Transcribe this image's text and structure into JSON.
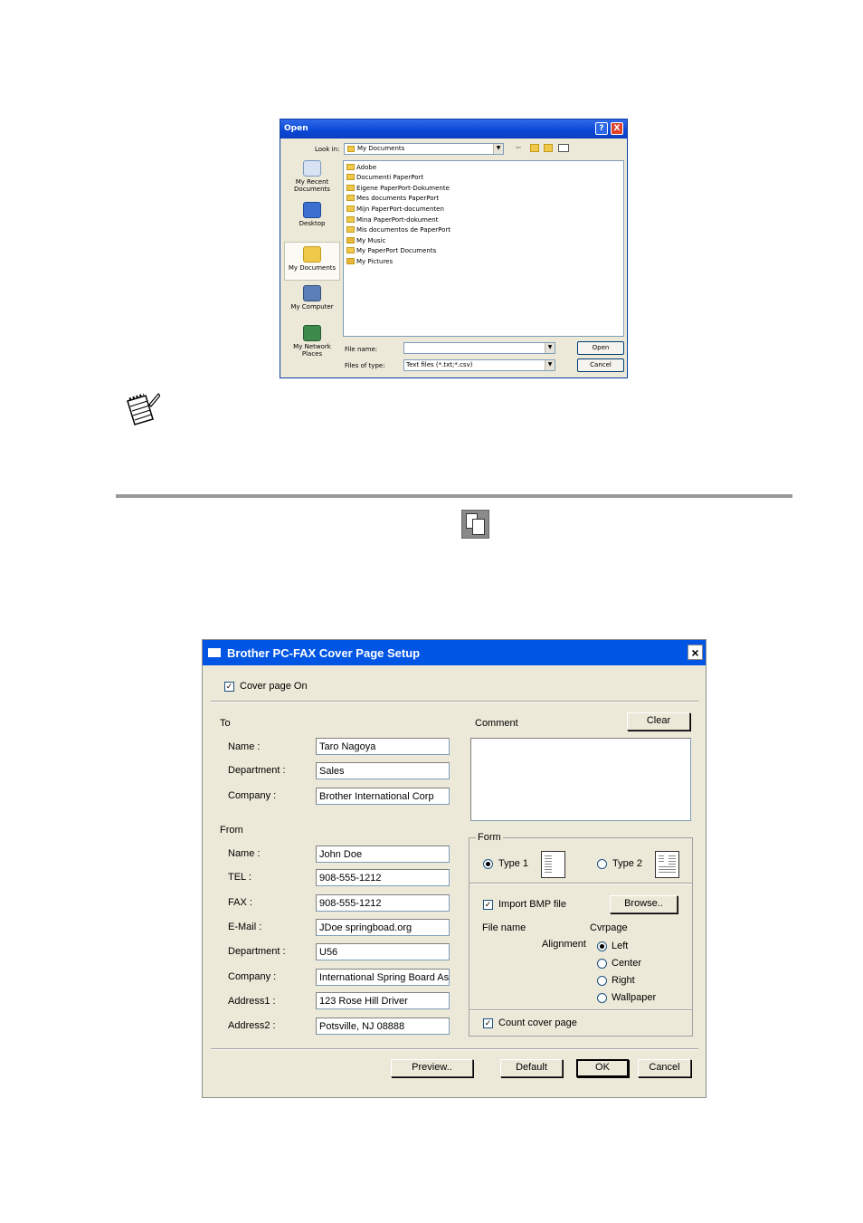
{
  "open_dialog": {
    "title": "Open",
    "help_btn": "?",
    "close_btn": "X",
    "look_in_label": "Look in:",
    "look_in_value": "My Documents",
    "places": [
      {
        "label": "My Recent Documents"
      },
      {
        "label": "Desktop"
      },
      {
        "label": "My Documents"
      },
      {
        "label": "My Computer"
      },
      {
        "label": "My Network Places"
      }
    ],
    "files": [
      "Adobe",
      "Documenti PaperPort",
      "Eigene PaperPort-Dokumente",
      "Mes documents PaperPort",
      "Mijn PaperPort-documenten",
      "Mina PaperPort-dokument",
      "Mis documentos de PaperPort",
      "My Music",
      "My PaperPort Documents",
      "My Pictures"
    ],
    "file_name_label": "File name:",
    "file_name_value": "",
    "files_of_type_label": "Files of type:",
    "files_of_type_value": "Text files (*.txt;*.csv)",
    "open_btn": "Open",
    "cancel_btn": "Cancel"
  },
  "cover_dialog": {
    "title": "Brother PC-FAX Cover Page Setup",
    "close_btn": "×",
    "cover_page_on_label": "Cover page On",
    "to_label": "To",
    "to": {
      "name_label": "Name :",
      "name_value": "Taro Nagoya",
      "department_label": "Department :",
      "department_value": "Sales",
      "company_label": "Company :",
      "company_value": "Brother International Corp"
    },
    "from_label": "From",
    "from": {
      "name_label": "Name :",
      "name_value": "John Doe",
      "tel_label": "TEL :",
      "tel_value": "908-555-1212",
      "fax_label": "FAX :",
      "fax_value": "908-555-1212",
      "email_label": "E-Mail :",
      "email_value": "JDoe springboad.org",
      "department_label": "Department :",
      "department_value": "U56",
      "company_label": "Company :",
      "company_value": "International Spring Board Asso",
      "address1_label": "Address1 :",
      "address1_value": "123 Rose Hill Driver",
      "address2_label": "Address2 :",
      "address2_value": "Potsville, NJ 08888"
    },
    "comment_label": "Comment",
    "clear_btn": "Clear",
    "comment_value": "",
    "form_label": "Form",
    "type1_label": "Type 1",
    "type2_label": "Type 2",
    "import_bmp_label": "Import BMP file",
    "browse_btn": "Browse..",
    "file_name_label": "File name",
    "cvrpage_label": "Cvrpage",
    "alignment_label": "Alignment",
    "align_options": [
      "Left",
      "Center",
      "Right",
      "Wallpaper"
    ],
    "count_cover_label": "Count cover page",
    "preview_btn": "Preview..",
    "default_btn": "Default",
    "ok_btn": "OK",
    "cancel_btn": "Cancel"
  }
}
